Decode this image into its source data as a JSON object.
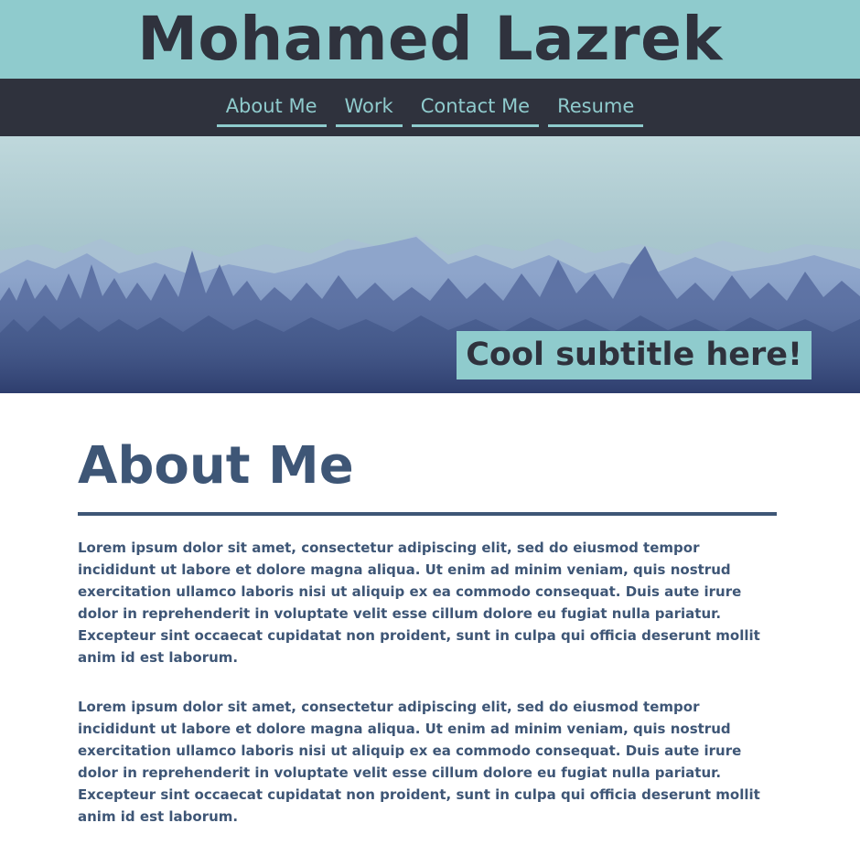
{
  "header": {
    "title": "Mohamed Lazrek"
  },
  "nav": {
    "items": [
      {
        "label": "About Me"
      },
      {
        "label": "Work"
      },
      {
        "label": "Contact Me"
      },
      {
        "label": "Resume"
      }
    ]
  },
  "hero": {
    "subtitle": "Cool subtitle here!"
  },
  "main": {
    "heading": "About Me",
    "paragraphs": [
      "Lorem ipsum dolor sit amet, consectetur adipiscing elit, sed do eiusmod tempor incididunt ut labore et dolore magna aliqua. Ut enim ad minim veniam, quis nostrud exercitation ullamco laboris nisi ut aliquip ex ea commodo consequat. Duis aute irure dolor in reprehenderit in voluptate velit esse cillum dolore eu fugiat nulla pariatur. Excepteur sint occaecat cupidatat non proident, sunt in culpa qui officia deserunt mollit anim id est laborum.",
      "Lorem ipsum dolor sit amet, consectetur adipiscing elit, sed do eiusmod tempor incididunt ut labore et dolore magna aliqua. Ut enim ad minim veniam, quis nostrud exercitation ullamco laboris nisi ut aliquip ex ea commodo consequat. Duis aute irure dolor in reprehenderit in voluptate velit esse cillum dolore eu fugiat nulla pariatur. Excepteur sint occaecat cupidatat non proident, sunt in culpa qui officia deserunt mollit anim id est laborum."
    ]
  },
  "colors": {
    "header_bg": "#8fcbcd",
    "nav_bg": "#2f323d",
    "accent": "#8fcbcd",
    "text": "#3e5676"
  }
}
